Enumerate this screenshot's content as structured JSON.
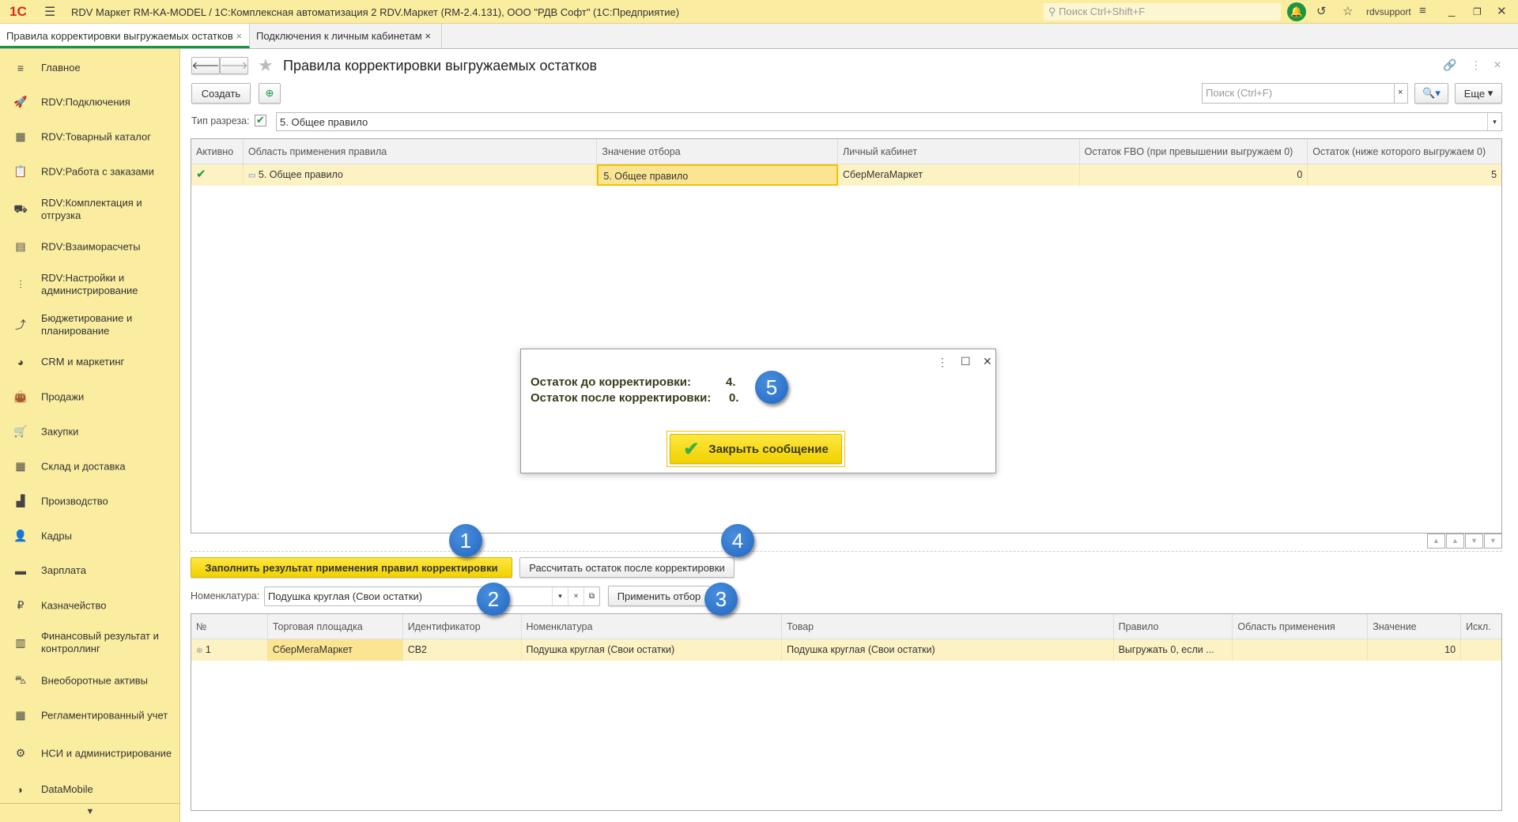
{
  "titlebar": {
    "logo": "1С",
    "title": "RDV Маркет RM-KA-MODEL / 1С:Комплексная автоматизация 2 RDV.Маркет (RM-2.4.131), ООО \"РДВ Софт\"  (1С:Предприятие)",
    "search_placeholder": "Поиск Ctrl+Shift+F",
    "user": "rdvsupport"
  },
  "tabs": [
    {
      "label": "Правила корректировки выгружаемых остатков",
      "close": "×"
    },
    {
      "label": "Подключения к личным кабинетам",
      "close": "×"
    }
  ],
  "sidebar": {
    "items": [
      {
        "label": "Главное",
        "icon": "≡"
      },
      {
        "label": "RDV:Подключения",
        "icon": "🚀"
      },
      {
        "label": "RDV:Товарный каталог",
        "icon": "▦"
      },
      {
        "label": "RDV:Работа с заказами",
        "icon": "📋"
      },
      {
        "label": "RDV:Комплектация и отгрузка",
        "icon": "⛟"
      },
      {
        "label": "RDV:Взаиморасчеты",
        "icon": "▤"
      },
      {
        "label": "RDV:Настройки и администрирование",
        "icon": "⫶"
      },
      {
        "label": "Бюджетирование и планирование",
        "icon": "⤴"
      },
      {
        "label": "CRM и маркетинг",
        "icon": "◕"
      },
      {
        "label": "Продажи",
        "icon": "👜"
      },
      {
        "label": "Закупки",
        "icon": "🛒"
      },
      {
        "label": "Склад и доставка",
        "icon": "▦"
      },
      {
        "label": "Производство",
        "icon": "▟"
      },
      {
        "label": "Кадры",
        "icon": "👤"
      },
      {
        "label": "Зарплата",
        "icon": "▬"
      },
      {
        "label": "Казначейство",
        "icon": "₽"
      },
      {
        "label": "Финансовый результат и контроллинг",
        "icon": "▥"
      },
      {
        "label": "Внеоборотные активы",
        "icon": "⛍"
      },
      {
        "label": "Регламентированный учет",
        "icon": "▦"
      },
      {
        "label": "НСИ и администрирование",
        "icon": "⚙"
      },
      {
        "label": "DataMobile",
        "icon": "◗"
      }
    ]
  },
  "form": {
    "title": "Правила корректировки выгружаемых остатков",
    "create": "Создать",
    "search_placeholder": "Поиск (Ctrl+F)",
    "search_clear": "×",
    "more": "Еще",
    "slice_label": "Тип разреза:",
    "slice_value": "5. Общее правило"
  },
  "rules_table": {
    "columns": [
      "Активно",
      "Область применения правила",
      "Значение отбора",
      "Личный кабинет",
      "Остаток FBO (при превышении выгружаем 0)",
      "Остаток (ниже которого выгружаем 0)"
    ],
    "rows": [
      {
        "active": "✔",
        "scope": "5. Общее правило",
        "value": "5. Общее правило",
        "cabinet": "СберМегаМаркет",
        "fbo": "0",
        "min": "5"
      }
    ]
  },
  "actions": {
    "fill": "Заполнить результат применения правил корректировки",
    "calc": "Рассчитать остаток после корректировки",
    "nom_label": "Номенклатура:",
    "nom_value": "Подушка круглая (Свои остатки)",
    "apply": "Применить отбор"
  },
  "result_table": {
    "columns": [
      "№",
      "Торговая площадка",
      "Идентификатор",
      "Номенклатура",
      "Товар",
      "Правило",
      "Область применения",
      "Значение",
      "Искл."
    ],
    "rows": [
      {
        "n": "1",
        "market": "СберМегаМаркет",
        "id": "CB2",
        "nom": "Подушка круглая (Свои остатки)",
        "item": "Подушка круглая (Свои остатки)",
        "rule": "Выгружать 0, если ...",
        "scope": "",
        "value": "10",
        "excl": ""
      }
    ]
  },
  "dialog": {
    "line1_label": "Остаток до корректировки:",
    "line1_value": "4.",
    "line2_label": "Остаток после корректировки:",
    "line2_value": "0.",
    "close_btn": "Закрыть сообщение"
  },
  "badges": [
    "1",
    "2",
    "3",
    "4",
    "5"
  ],
  "colors": {
    "panel": "#fbeda0",
    "accent": "#f0d200",
    "badge": "#2f78d0",
    "active_tab": "#1a9640"
  }
}
